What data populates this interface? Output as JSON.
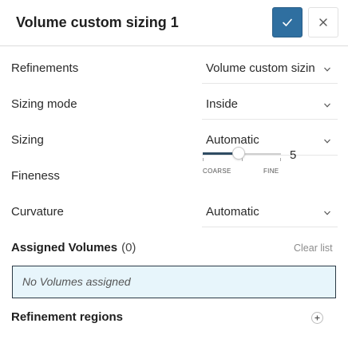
{
  "header": {
    "title": "Volume custom sizing 1",
    "confirm_icon": "check-icon",
    "close_icon": "close-icon",
    "accent_color": "#2f6fa0"
  },
  "rows": {
    "refinements": {
      "label": "Refinements",
      "value": "Volume custom sizin"
    },
    "sizing_mode": {
      "label": "Sizing mode",
      "value": "Inside"
    },
    "sizing": {
      "label": "Sizing",
      "value": "Automatic"
    },
    "fineness": {
      "label": "Fineness",
      "value": "5",
      "min_label": "COARSE",
      "max_label": "FINE",
      "level_fraction": 0.4
    },
    "curvature": {
      "label": "Curvature",
      "value": "Automatic"
    }
  },
  "assigned": {
    "label": "Assigned Volumes",
    "count": "(0)",
    "clear_label": "Clear list",
    "empty_text": "No Volumes assigned"
  },
  "regions": {
    "label": "Refinement regions",
    "add_icon": "plus-icon"
  }
}
